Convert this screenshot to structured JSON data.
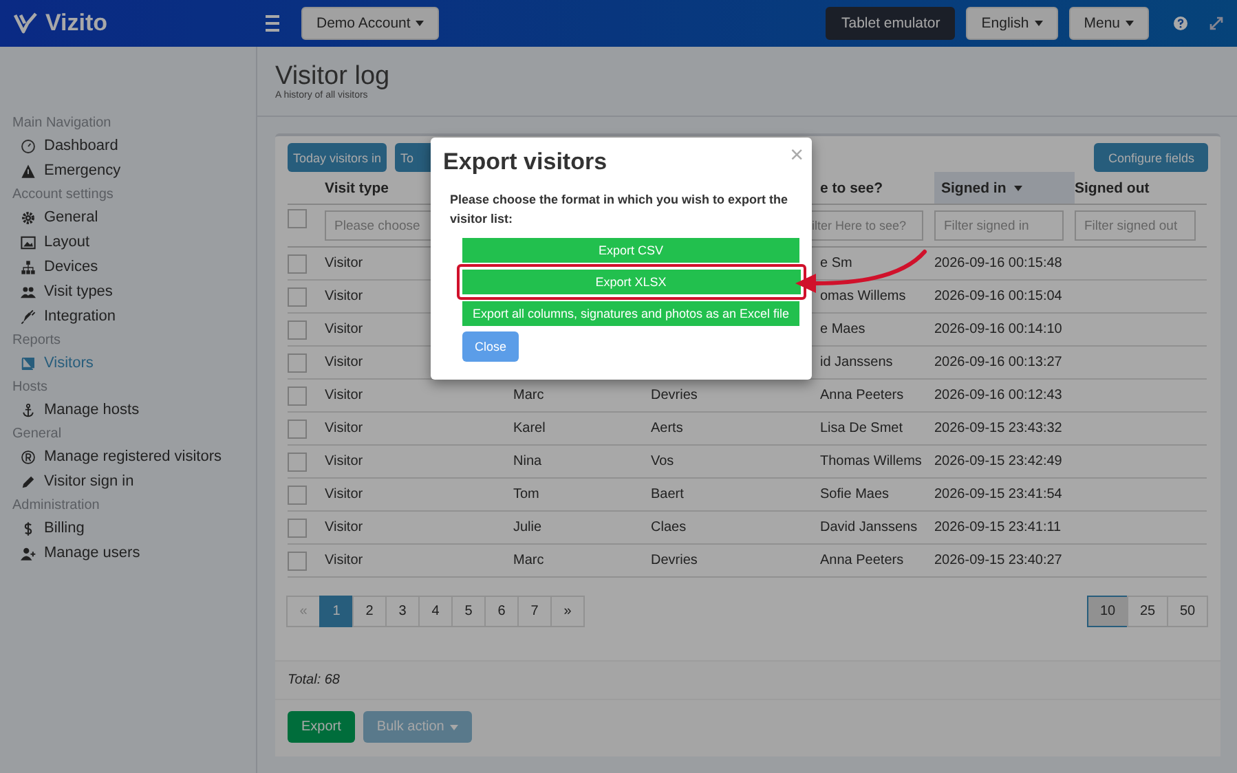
{
  "topbar": {
    "logo": "Vizito",
    "account": "Demo Account",
    "buttons": [
      {
        "label": "Tablet emulator",
        "kind": "dark"
      },
      {
        "label": "English",
        "kind": "dropdown"
      },
      {
        "label": "Menu",
        "kind": "dropdown"
      }
    ]
  },
  "sidebar": [
    {
      "title": "Main Navigation",
      "items": [
        {
          "label": "Dashboard",
          "selected": false
        },
        {
          "label": "Emergency",
          "selected": false
        }
      ]
    },
    {
      "title": "Account settings",
      "items": [
        {
          "label": "General",
          "selected": false
        },
        {
          "label": "Layout",
          "selected": false
        },
        {
          "label": "Devices",
          "selected": false
        },
        {
          "label": "Visit types",
          "selected": false
        },
        {
          "label": "Integration",
          "selected": false
        }
      ]
    },
    {
      "title": "Reports",
      "items": [
        {
          "label": "Visitors",
          "selected": true
        }
      ]
    },
    {
      "title": "Hosts",
      "items": [
        {
          "label": "Manage hosts",
          "selected": false
        }
      ]
    },
    {
      "title": "General",
      "items": [
        {
          "label": "Manage registered visitors",
          "selected": false
        },
        {
          "label": "Visitor sign in",
          "selected": false
        }
      ]
    },
    {
      "title": "Administration",
      "items": [
        {
          "label": "Billing",
          "selected": false
        },
        {
          "label": "Manage users",
          "selected": false
        }
      ]
    }
  ],
  "page": {
    "title": "Visitor log",
    "subtitle": "A history of all visitors"
  },
  "toolbar": {
    "buttons": [
      "Today visitors in",
      "To"
    ],
    "configure": "Configure fields"
  },
  "table": {
    "columns": {
      "visit_type": {
        "label": "Visit type",
        "sorted": false
      },
      "host": {
        "label": "e to see?",
        "sorted": false
      },
      "signed_in": {
        "label": "Signed in",
        "sorted": true
      },
      "signed_out": {
        "label": "Signed out",
        "sorted": false
      }
    },
    "select_all_checked": false,
    "filters": {
      "visit_type": {
        "placeholder": "Please choose"
      },
      "host": {
        "placeholder": "ilter Here to see?"
      },
      "signed_in": {
        "placeholder": "Filter signed in"
      },
      "signed_out": {
        "placeholder": "Filter signed out"
      }
    },
    "rows": [
      {
        "checked": false,
        "visit_type": "Visitor",
        "host": "e Sm",
        "signed_in": "2026-09-16 00:15:48"
      },
      {
        "checked": false,
        "visit_type": "Visitor",
        "host": "omas Willems",
        "signed_in": "2026-09-16 00:15:04"
      },
      {
        "checked": false,
        "visit_type": "Visitor",
        "host": "e Maes",
        "signed_in": "2026-09-16 00:14:10"
      },
      {
        "checked": false,
        "visit_type": "Visitor",
        "host": "id Janssens",
        "signed_in": "2026-09-16 00:13:27"
      },
      {
        "checked": false,
        "visit_type": "Visitor",
        "first_name": "Marc",
        "last_name": "Devries",
        "host": "Anna Peeters",
        "signed_in": "2026-09-16 00:12:43"
      },
      {
        "checked": false,
        "visit_type": "Visitor",
        "first_name": "Karel",
        "last_name": "Aerts",
        "host": "Lisa De Smet",
        "signed_in": "2026-09-15 23:43:32"
      },
      {
        "checked": false,
        "visit_type": "Visitor",
        "first_name": "Nina",
        "last_name": "Vos",
        "host": "Thomas Willems",
        "signed_in": "2026-09-15 23:42:49"
      },
      {
        "checked": false,
        "visit_type": "Visitor",
        "first_name": "Tom",
        "last_name": "Baert",
        "host": "Sofie Maes",
        "signed_in": "2026-09-15 23:41:54"
      },
      {
        "checked": false,
        "visit_type": "Visitor",
        "first_name": "Julie",
        "last_name": "Claes",
        "host": "David Janssens",
        "signed_in": "2026-09-15 23:41:11"
      },
      {
        "checked": false,
        "visit_type": "Visitor",
        "first_name": "Marc",
        "last_name": "Devries",
        "host": "Anna Peeters",
        "signed_in": "2026-09-15 23:40:27"
      }
    ]
  },
  "pagination": {
    "pages": [
      {
        "label": "«",
        "selected": false,
        "disabled": true
      },
      {
        "label": "1",
        "selected": true,
        "disabled": false
      },
      {
        "label": "2",
        "selected": false,
        "disabled": false
      },
      {
        "label": "3",
        "selected": false,
        "disabled": false
      },
      {
        "label": "4",
        "selected": false,
        "disabled": false
      },
      {
        "label": "5",
        "selected": false,
        "disabled": false
      },
      {
        "label": "6",
        "selected": false,
        "disabled": false
      },
      {
        "label": "7",
        "selected": false,
        "disabled": false
      },
      {
        "label": "»",
        "selected": false,
        "disabled": false
      }
    ],
    "page_sizes": [
      {
        "label": "10",
        "selected": true
      },
      {
        "label": "25",
        "selected": false
      },
      {
        "label": "50",
        "selected": false
      }
    ]
  },
  "total": "Total: 68",
  "footer_buttons": [
    {
      "label": "Export",
      "kind": "success",
      "disabled": false
    },
    {
      "label": "Bulk action",
      "kind": "dropdown",
      "disabled": true
    }
  ],
  "modal": {
    "title": "Export visitors",
    "close": "×",
    "text": "Please choose the format in which you wish to export the visitor list:",
    "options": [
      {
        "label": "Export CSV",
        "highlighted": false
      },
      {
        "label": "Export XLSX",
        "highlighted": true
      },
      {
        "label": "Export all columns, signatures and photos as an Excel file",
        "highlighted": false
      }
    ],
    "close_button": "Close"
  }
}
